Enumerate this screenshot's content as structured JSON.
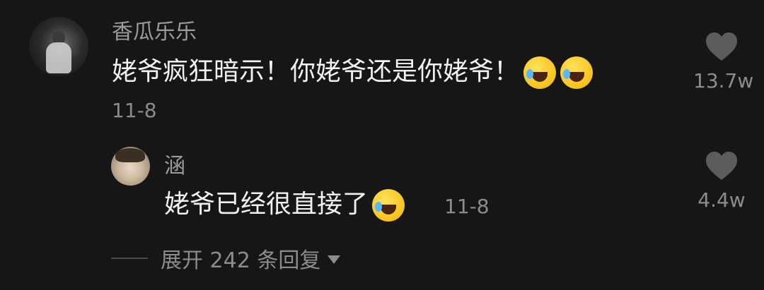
{
  "comment": {
    "username": "香瓜乐乐",
    "text": "姥爷疯狂暗示！你姥爷还是你姥爷！",
    "emojis": [
      "laughing-crying-emoji",
      "laughing-crying-emoji"
    ],
    "date": "11-8",
    "likes": "13.7w"
  },
  "reply": {
    "username": "涵",
    "text": "姥爷已经很直接了",
    "emojis": [
      "laughing-crying-emoji"
    ],
    "date": "11-8",
    "likes": "4.4w"
  },
  "expand": {
    "label": "展开 242 条回复"
  },
  "colors": {
    "background": "#161616",
    "text_primary": "#f1f1f1",
    "text_secondary": "#8c8c8c",
    "heart": "#5c5c5c"
  }
}
